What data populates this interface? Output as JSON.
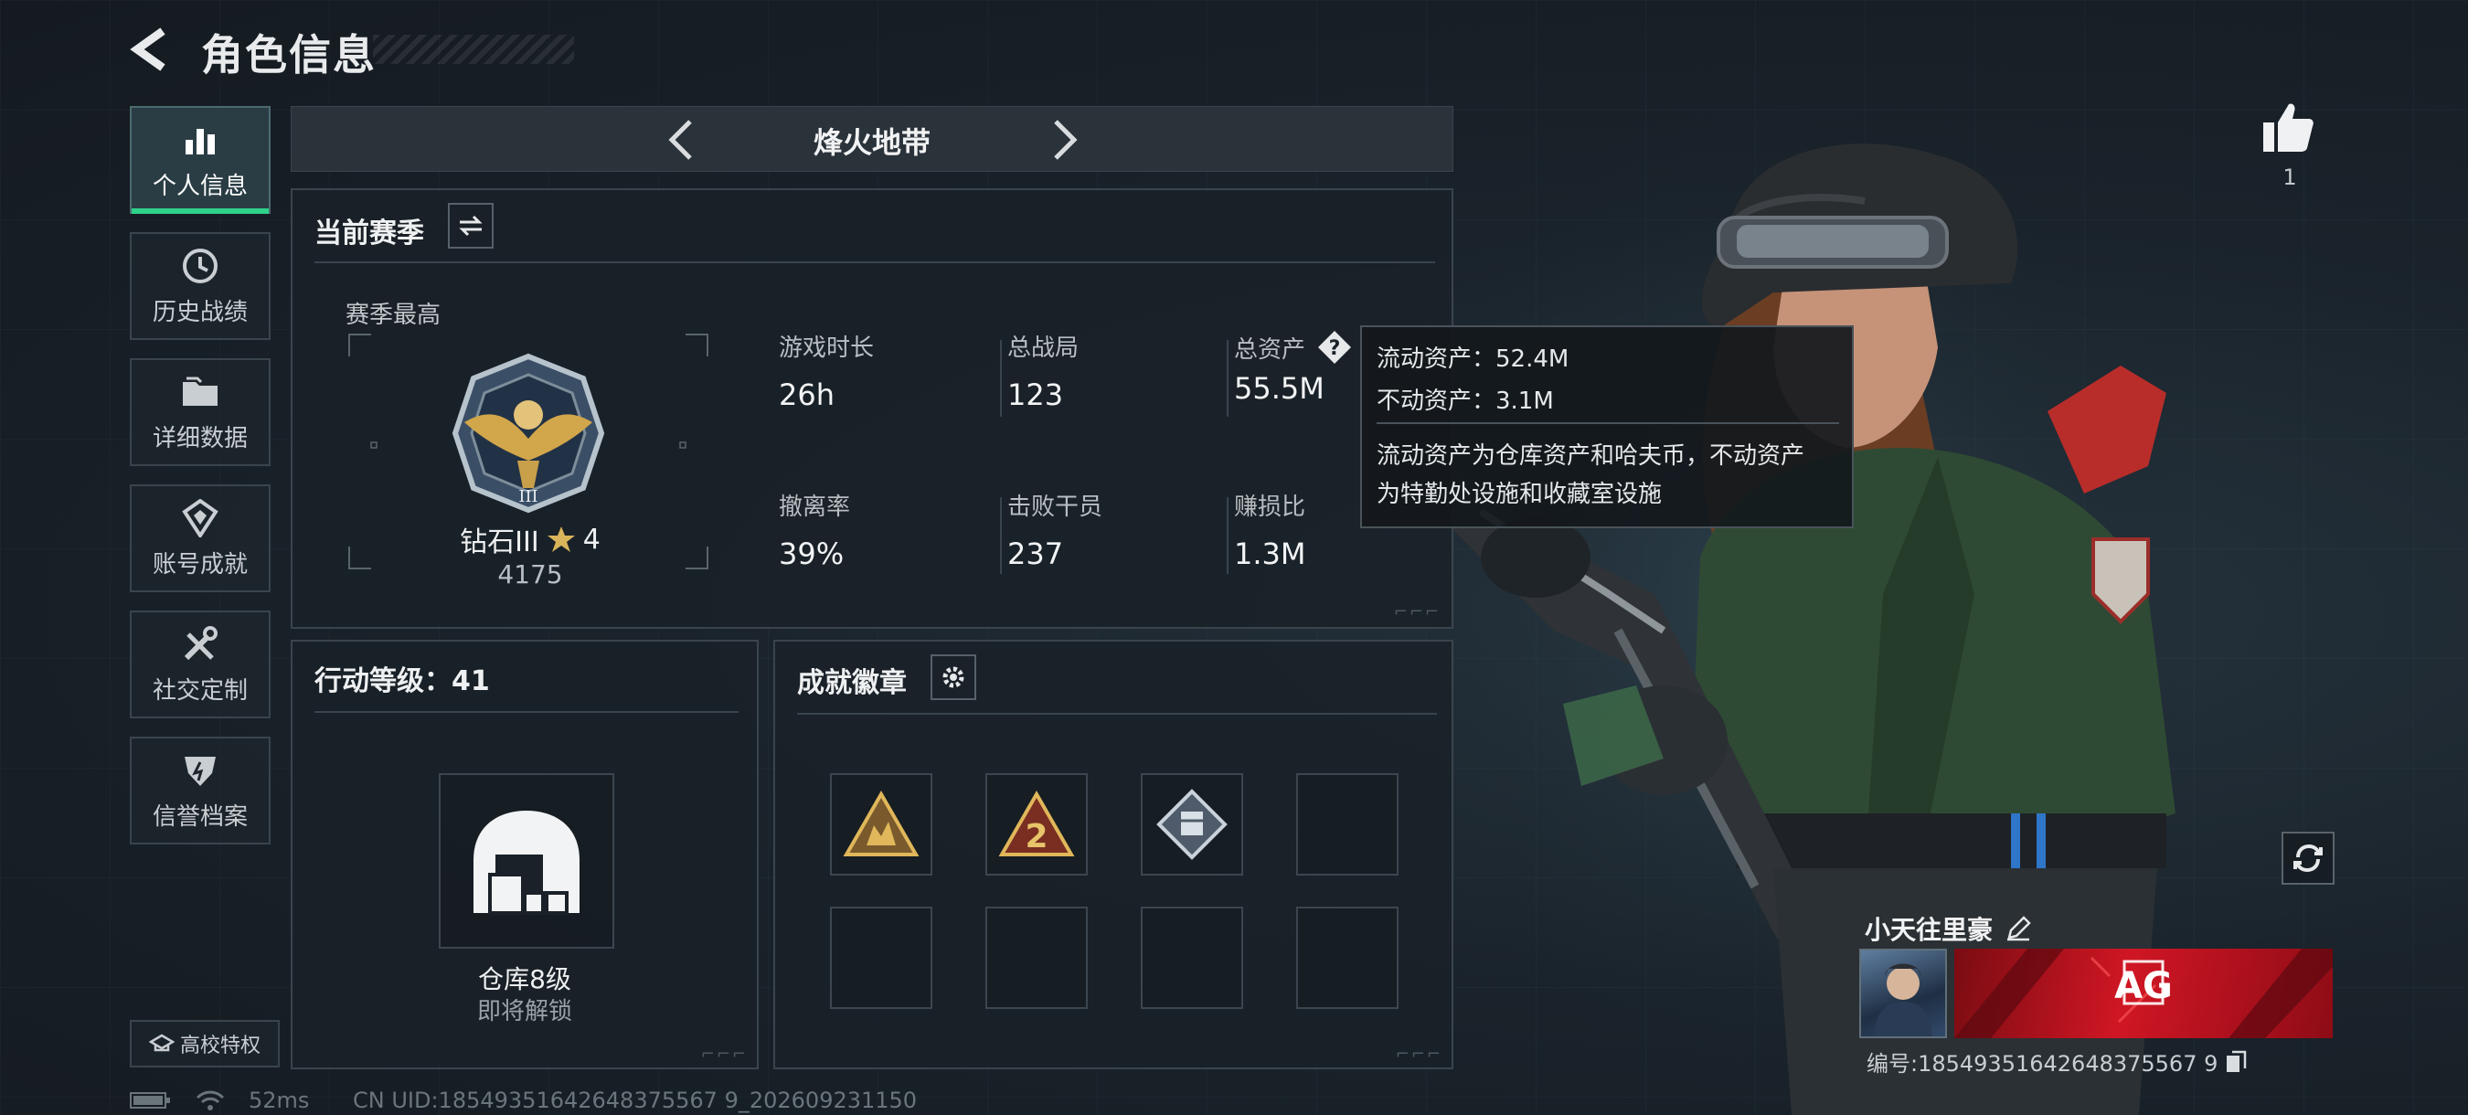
{
  "header": {
    "title": "角色信息"
  },
  "nav": [
    {
      "label": "个人信息",
      "icon": "bar-chart-icon",
      "active": true
    },
    {
      "label": "历史战绩",
      "icon": "history-clock-icon",
      "active": false
    },
    {
      "label": "详细数据",
      "icon": "folder-icon",
      "active": false
    },
    {
      "label": "账号成就",
      "icon": "achievement-icon",
      "active": false
    },
    {
      "label": "社交定制",
      "icon": "tools-icon",
      "active": false
    },
    {
      "label": "信誉档案",
      "icon": "credit-shield-icon",
      "active": false
    }
  ],
  "school_button": "高校特权",
  "status": {
    "ping": "52ms",
    "uid_line": "CN UID:18549351642648375567 9_202609231150"
  },
  "mode": {
    "title": "烽火地带"
  },
  "season": {
    "title": "当前赛季",
    "best_label": "赛季最高",
    "rank_name": "钻石III",
    "rank_stars": "4",
    "rank_score": "4175",
    "stats": [
      {
        "label": "游戏时长",
        "value": "26h"
      },
      {
        "label": "总战局",
        "value": "123"
      },
      {
        "label": "总资产",
        "value": "55.5M"
      },
      {
        "label": "撤离率",
        "value": "39%"
      },
      {
        "label": "击败干员",
        "value": "237"
      },
      {
        "label": "赚损比",
        "value": "1.3M"
      }
    ]
  },
  "tooltip": {
    "liquid": "流动资产：52.4M",
    "fixed": "不动资产：3.1M",
    "desc1": "流动资产为仓库资产和哈夫币，不动资产",
    "desc2": "为特勤处设施和收藏室设施"
  },
  "action_level": {
    "title": "行动等级：41",
    "unlock_name": "仓库8级",
    "unlock_status": "即将解锁"
  },
  "achievements": {
    "title": "成就徽章"
  },
  "likes": {
    "count": "1"
  },
  "player": {
    "name": "小天往里豪",
    "id_line": "编号:18549351642648375567 9",
    "banner_text": "AG"
  },
  "colors": {
    "accent": "#2fd28a",
    "gold": "#d2a64a",
    "banner_red": "#d01624"
  }
}
